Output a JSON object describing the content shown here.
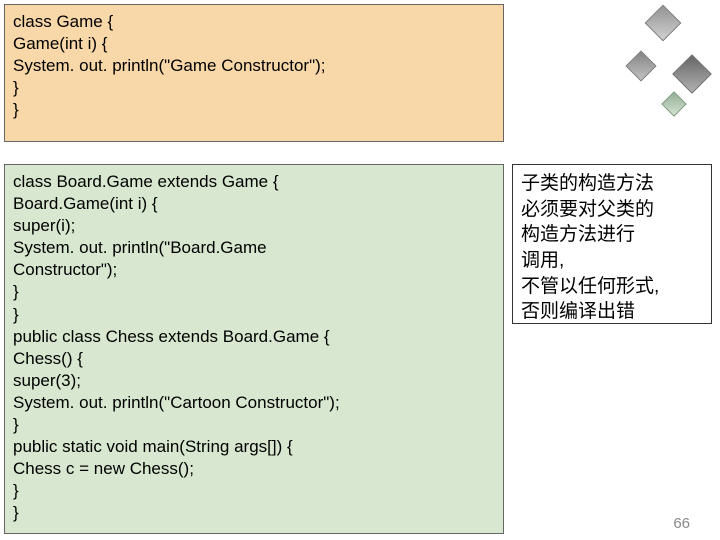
{
  "code1": {
    "l1": "class Game {",
    "l2": "    Game(int i) {",
    "l3": "          System. out. println(\"Game Constructor\");",
    "l4": "    }",
    "l5": "}"
  },
  "code2": {
    "l1": "class Board.Game extends Game {",
    "l2": "    Board.Game(int i) {",
    "l3": "       super(i);",
    "l4": "       System. out. println(\"Board.Game",
    "l5": "    Constructor\");",
    "l6": "    }",
    "l7": "}",
    "l8": "public class Chess extends Board.Game {",
    "l9": "    Chess() {",
    "l10": "          super(3);",
    "l11": "          System. out. println(\"Cartoon Constructor\");",
    "l12": "    }",
    "l13": "    public static void main(String args[]) {",
    "l14": "          Chess c = new Chess();",
    "l15": "    }",
    "l16": "}"
  },
  "note": {
    "l1": "子类的构造方法",
    "l2": "必须要对父类的",
    "l3": "构造方法进行",
    "l4": "调用,",
    "l5": "不管以任何形式,",
    "l6": "否则编译出错"
  },
  "page_number": "66"
}
